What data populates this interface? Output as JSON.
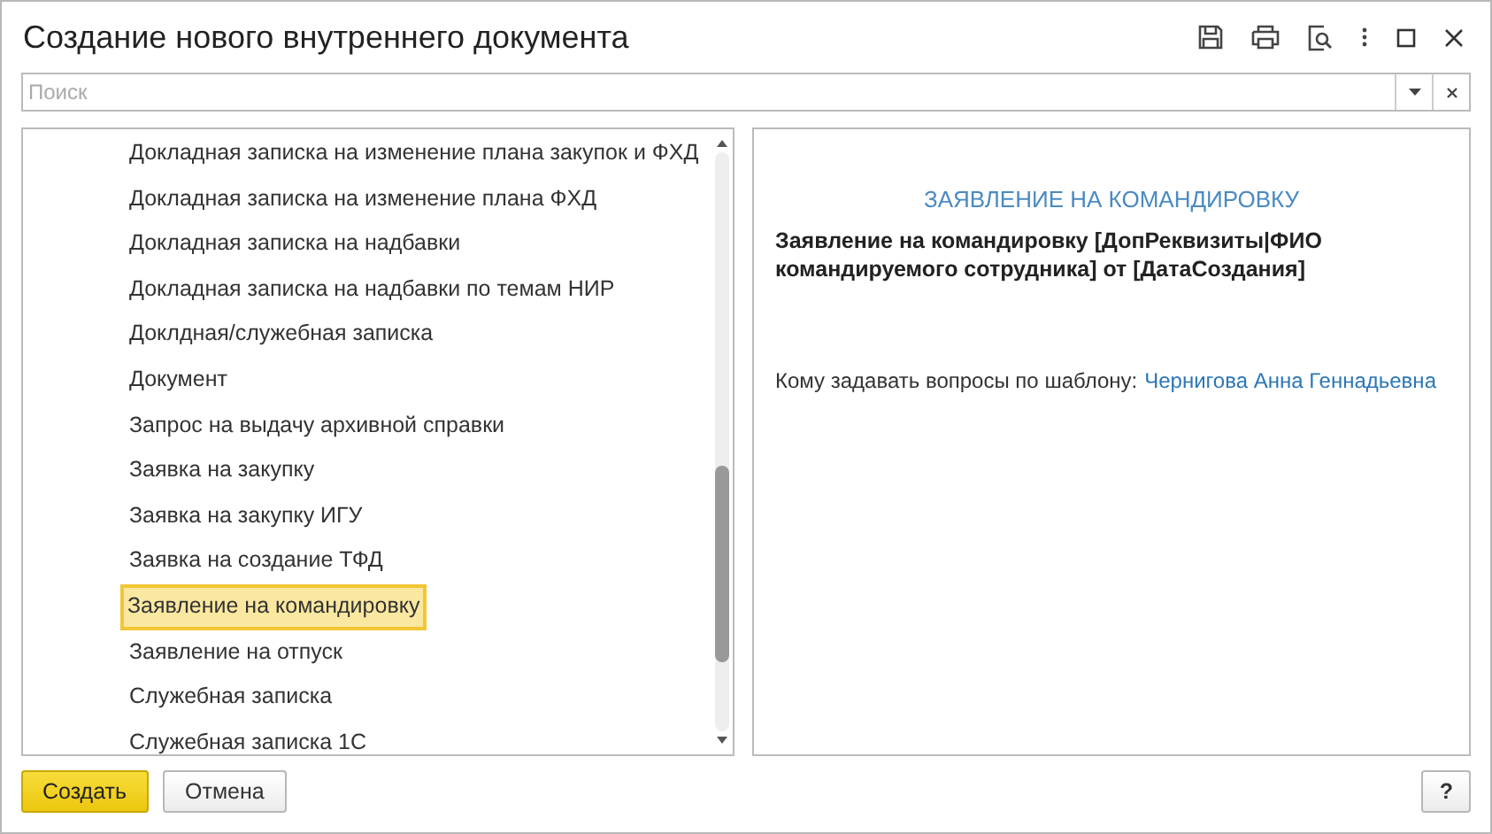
{
  "window": {
    "title": "Создание нового внутреннего документа"
  },
  "search": {
    "placeholder": "Поиск"
  },
  "template_list": {
    "items": [
      {
        "label": "Докладная записка на изменение плана закупок и ФХД",
        "selected": false
      },
      {
        "label": "Докладная записка на изменение плана ФХД",
        "selected": false
      },
      {
        "label": "Докладная записка на надбавки",
        "selected": false
      },
      {
        "label": "Докладная записка на надбавки по темам НИР",
        "selected": false
      },
      {
        "label": "Доклдная/служебная записка",
        "selected": false
      },
      {
        "label": "Документ",
        "selected": false
      },
      {
        "label": "Запрос на выдачу архивной справки",
        "selected": false
      },
      {
        "label": "Заявка на закупку",
        "selected": false
      },
      {
        "label": "Заявка на закупку ИГУ",
        "selected": false
      },
      {
        "label": "Заявка на создание ТФД",
        "selected": false
      },
      {
        "label": "Заявление на командировку",
        "selected": true
      },
      {
        "label": "Заявление на отпуск",
        "selected": false
      },
      {
        "label": "Служебная записка",
        "selected": false
      },
      {
        "label": "Служебная записка 1С",
        "selected": false
      }
    ]
  },
  "preview": {
    "heading": "ЗАЯВЛЕНИЕ НА КОМАНДИРОВКУ",
    "subject": "Заявление на командировку [ДопРеквизиты|ФИО командируемого сотрудника] от [ДатаСоздания]",
    "contact_label": "Кому задавать вопросы по шаблону:",
    "contact_name": "Чернигова Анна Геннадьевна"
  },
  "buttons": {
    "create": "Создать",
    "cancel": "Отмена",
    "help": "?"
  }
}
